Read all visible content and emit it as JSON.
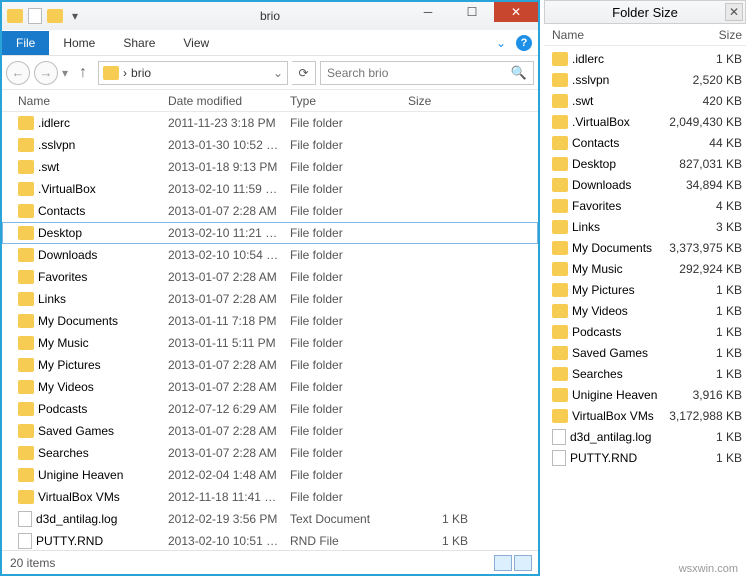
{
  "window": {
    "title": "brio",
    "file_tab": "File",
    "tabs": [
      "Home",
      "Share",
      "View"
    ],
    "help_tooltip": "?"
  },
  "nav": {
    "chevron": "›",
    "path_label": "brio",
    "refresh": "⟳",
    "search_placeholder": "Search brio"
  },
  "columns": {
    "name": "Name",
    "date": "Date modified",
    "type": "Type",
    "size": "Size"
  },
  "items": [
    {
      "name": ".idlerc",
      "date": "2011-11-23 3:18 PM",
      "type": "File folder",
      "size": "",
      "icon": "folder",
      "selected": false
    },
    {
      "name": ".sslvpn",
      "date": "2013-01-30 10:52 …",
      "type": "File folder",
      "size": "",
      "icon": "folder",
      "selected": false
    },
    {
      "name": ".swt",
      "date": "2013-01-18 9:13 PM",
      "type": "File folder",
      "size": "",
      "icon": "folder",
      "selected": false
    },
    {
      "name": ".VirtualBox",
      "date": "2013-02-10 11:59 …",
      "type": "File folder",
      "size": "",
      "icon": "folder",
      "selected": false
    },
    {
      "name": "Contacts",
      "date": "2013-01-07 2:28 AM",
      "type": "File folder",
      "size": "",
      "icon": "folder",
      "selected": false
    },
    {
      "name": "Desktop",
      "date": "2013-02-10 11:21 …",
      "type": "File folder",
      "size": "",
      "icon": "folder",
      "selected": true
    },
    {
      "name": "Downloads",
      "date": "2013-02-10 10:54 …",
      "type": "File folder",
      "size": "",
      "icon": "folder",
      "selected": false
    },
    {
      "name": "Favorites",
      "date": "2013-01-07 2:28 AM",
      "type": "File folder",
      "size": "",
      "icon": "folder",
      "selected": false
    },
    {
      "name": "Links",
      "date": "2013-01-07 2:28 AM",
      "type": "File folder",
      "size": "",
      "icon": "folder",
      "selected": false
    },
    {
      "name": "My Documents",
      "date": "2013-01-11 7:18 PM",
      "type": "File folder",
      "size": "",
      "icon": "folder",
      "selected": false
    },
    {
      "name": "My Music",
      "date": "2013-01-11 5:11 PM",
      "type": "File folder",
      "size": "",
      "icon": "folder",
      "selected": false
    },
    {
      "name": "My Pictures",
      "date": "2013-01-07 2:28 AM",
      "type": "File folder",
      "size": "",
      "icon": "folder",
      "selected": false
    },
    {
      "name": "My Videos",
      "date": "2013-01-07 2:28 AM",
      "type": "File folder",
      "size": "",
      "icon": "folder",
      "selected": false
    },
    {
      "name": "Podcasts",
      "date": "2012-07-12 6:29 AM",
      "type": "File folder",
      "size": "",
      "icon": "folder",
      "selected": false
    },
    {
      "name": "Saved Games",
      "date": "2013-01-07 2:28 AM",
      "type": "File folder",
      "size": "",
      "icon": "folder",
      "selected": false
    },
    {
      "name": "Searches",
      "date": "2013-01-07 2:28 AM",
      "type": "File folder",
      "size": "",
      "icon": "folder",
      "selected": false
    },
    {
      "name": "Unigine Heaven",
      "date": "2012-02-04 1:48 AM",
      "type": "File folder",
      "size": "",
      "icon": "folder",
      "selected": false
    },
    {
      "name": "VirtualBox VMs",
      "date": "2012-11-18 11:41 …",
      "type": "File folder",
      "size": "",
      "icon": "folder",
      "selected": false
    },
    {
      "name": "d3d_antilag.log",
      "date": "2012-02-19 3:56 PM",
      "type": "Text Document",
      "size": "1 KB",
      "icon": "file",
      "selected": false
    },
    {
      "name": "PUTTY.RND",
      "date": "2013-02-10 10:51 …",
      "type": "RND File",
      "size": "1 KB",
      "icon": "file",
      "selected": false
    }
  ],
  "status": {
    "count": "20 items"
  },
  "panel": {
    "title": "Folder Size",
    "cols": {
      "name": "Name",
      "size": "Size"
    },
    "items": [
      {
        "name": ".idlerc",
        "size": "1 KB",
        "icon": "folder"
      },
      {
        "name": ".sslvpn",
        "size": "2,520 KB",
        "icon": "folder"
      },
      {
        "name": ".swt",
        "size": "420 KB",
        "icon": "folder"
      },
      {
        "name": ".VirtualBox",
        "size": "2,049,430 KB",
        "icon": "folder"
      },
      {
        "name": "Contacts",
        "size": "44 KB",
        "icon": "folder"
      },
      {
        "name": "Desktop",
        "size": "827,031 KB",
        "icon": "folder"
      },
      {
        "name": "Downloads",
        "size": "34,894 KB",
        "icon": "folder"
      },
      {
        "name": "Favorites",
        "size": "4 KB",
        "icon": "folder"
      },
      {
        "name": "Links",
        "size": "3 KB",
        "icon": "folder"
      },
      {
        "name": "My Documents",
        "size": "3,373,975 KB",
        "icon": "folder"
      },
      {
        "name": "My Music",
        "size": "292,924 KB",
        "icon": "folder"
      },
      {
        "name": "My Pictures",
        "size": "1 KB",
        "icon": "folder"
      },
      {
        "name": "My Videos",
        "size": "1 KB",
        "icon": "folder"
      },
      {
        "name": "Podcasts",
        "size": "1 KB",
        "icon": "folder"
      },
      {
        "name": "Saved Games",
        "size": "1 KB",
        "icon": "folder"
      },
      {
        "name": "Searches",
        "size": "1 KB",
        "icon": "folder"
      },
      {
        "name": "Unigine Heaven",
        "size": "3,916 KB",
        "icon": "folder"
      },
      {
        "name": "VirtualBox VMs",
        "size": "3,172,988 KB",
        "icon": "folder"
      },
      {
        "name": "d3d_antilag.log",
        "size": "1 KB",
        "icon": "file"
      },
      {
        "name": "PUTTY.RND",
        "size": "1 KB",
        "icon": "file"
      }
    ]
  },
  "watermark": "wsxwin.com"
}
